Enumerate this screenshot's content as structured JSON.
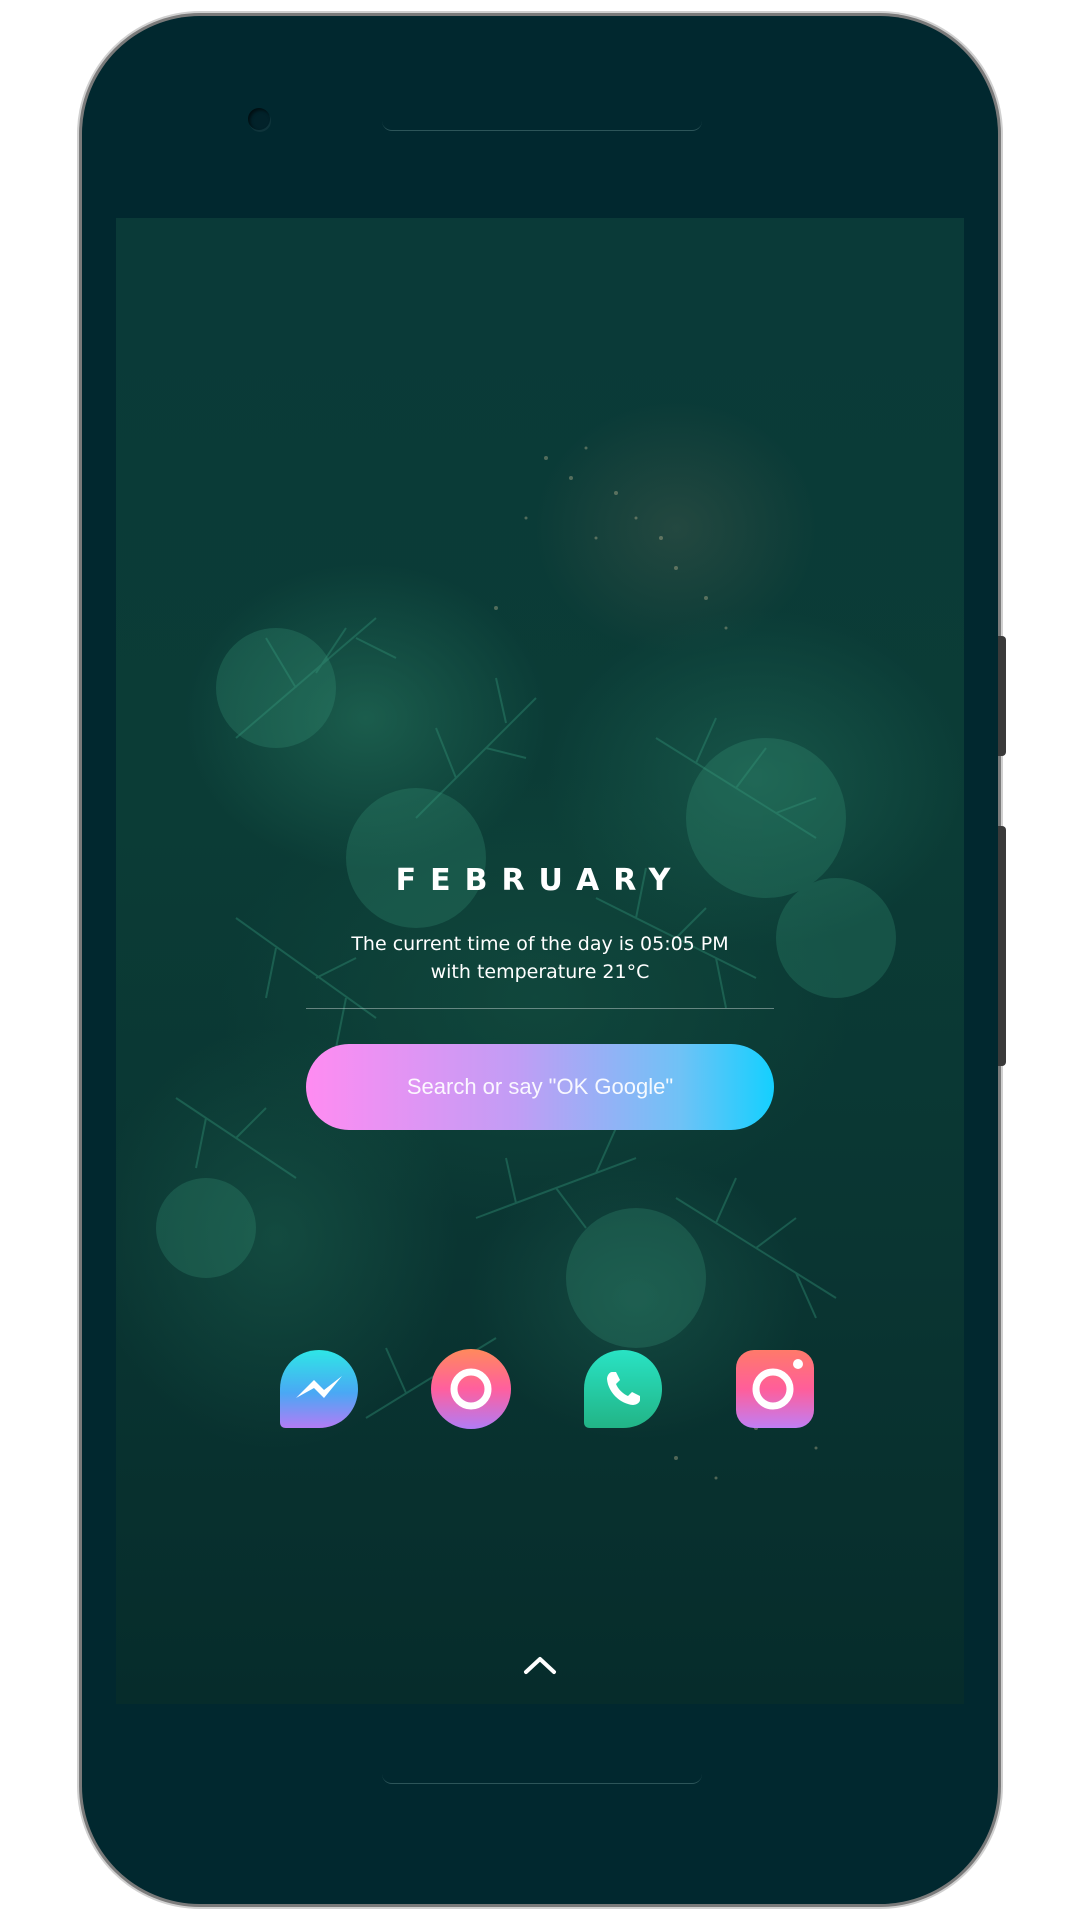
{
  "widget": {
    "month": "FEBRUARY",
    "line1": "The current time of the day is 05:05 PM",
    "line2": "with temperature 21°C"
  },
  "search": {
    "placeholder": "Search or say \"OK Google\""
  },
  "dock": [
    {
      "name": "messenger-app-icon",
      "icon": "lightning-bolt-icon"
    },
    {
      "name": "camera-round-app-icon",
      "icon": "ring-icon"
    },
    {
      "name": "phone-app-icon",
      "icon": "phone-handset-icon"
    },
    {
      "name": "camera-square-app-icon",
      "icon": "camera-lens-icon"
    }
  ],
  "colors": {
    "frame": "#01282f",
    "search_gradient_start": "#ff8cf2",
    "search_gradient_end": "#14d0ff",
    "text": "#ffffff"
  }
}
